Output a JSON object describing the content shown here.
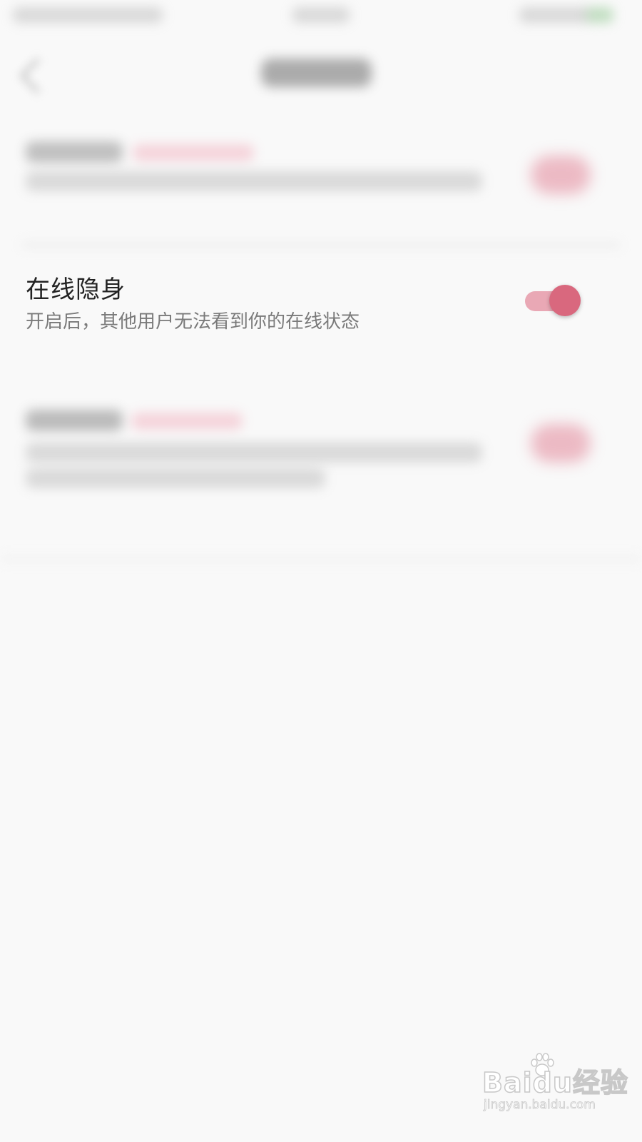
{
  "setting": {
    "title": "在线隐身",
    "description": "开启后，其他用户无法看到你的在线状态",
    "enabled": true
  },
  "watermark": {
    "logo": "Baidu经验",
    "url": "jingyan.baidu.com"
  },
  "colors": {
    "accent": "#d9687e",
    "track": "#e9a8b5",
    "background": "#f9f9f9"
  }
}
